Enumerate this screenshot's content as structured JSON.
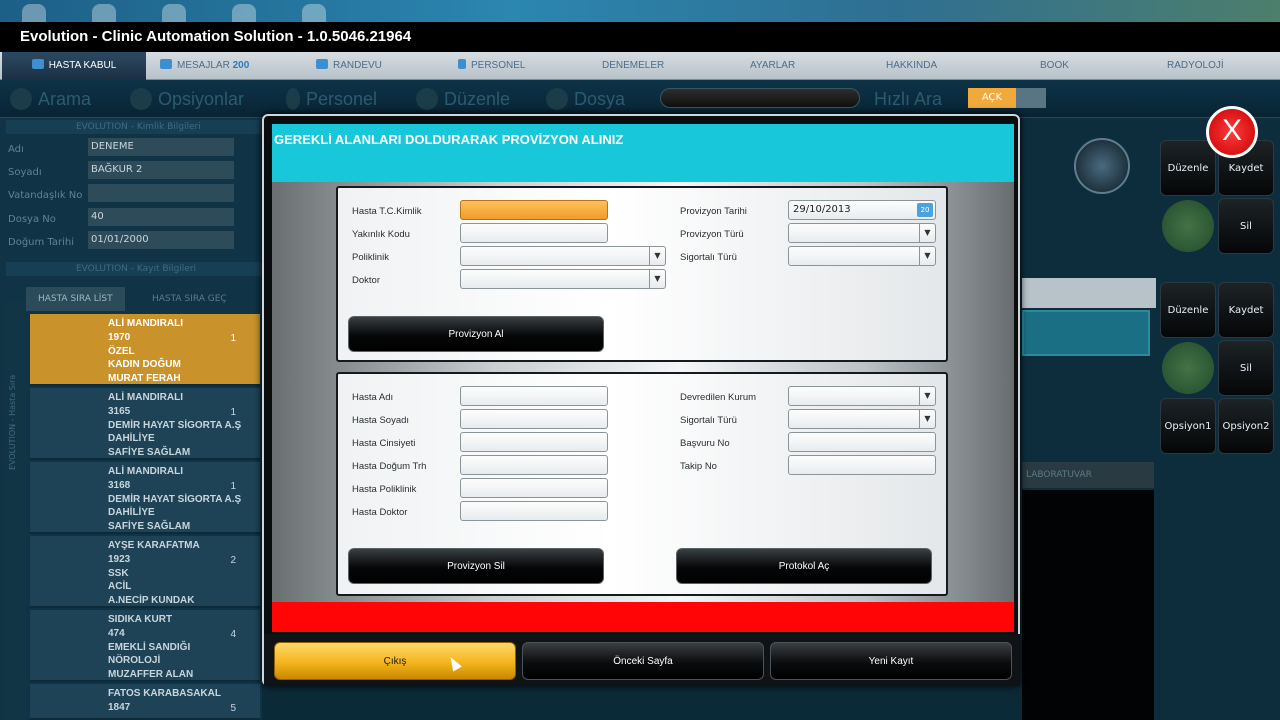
{
  "app": {
    "title": "Evolution - Clinic Automation Solution - 1.0.5046.21964"
  },
  "menu": {
    "items": [
      {
        "label": "HASTA KABUL"
      },
      {
        "label": "MESAJLAR",
        "badge": "200"
      },
      {
        "label": "RANDEVU"
      },
      {
        "label": "PERSONEL"
      },
      {
        "label": "DENEMELER"
      },
      {
        "label": "AYARLAR"
      },
      {
        "label": "HAKKINDA"
      },
      {
        "label": "BOOK"
      },
      {
        "label": "RADYOLOJİ"
      }
    ]
  },
  "toolbar": {
    "arama": "Arama",
    "opsiyonlar": "Opsiyonlar",
    "personel": "Personel",
    "duzenle": "Düzenle",
    "dosya": "Dosya",
    "hizli_ara": "Hızlı Ara",
    "ack": "AÇK"
  },
  "left": {
    "section1": "EVOLUTION - Kimlik Bilgileri",
    "fields": [
      {
        "label": "Adı",
        "value": "DENEME"
      },
      {
        "label": "Soyadı",
        "value": "BAĞKUR 2"
      },
      {
        "label": "Vatandaşlık No",
        "value": ""
      },
      {
        "label": "Dosya No",
        "value": "40"
      },
      {
        "label": "Doğum Tarihi",
        "value": "01/01/2000"
      }
    ],
    "section2": "EVOLUTION - Kayıt Bilgileri",
    "tabs": [
      "HASTA SIRA LİST",
      "HASTA SIRA GEÇ"
    ],
    "side_label": "EVOLUTION - Hasta Sıra",
    "patients": [
      {
        "lines": [
          "ALİ MANDIRALI",
          "1970",
          "ÖZEL",
          "KADIN DOĞUM",
          "MURAT FERAH"
        ],
        "n": "1"
      },
      {
        "lines": [
          "ALİ MANDIRALI",
          "3165",
          "DEMİR HAYAT SİGORTA A.Ş",
          "DAHİLİYE",
          "SAFİYE SAĞLAM"
        ],
        "n": "1"
      },
      {
        "lines": [
          "ALİ MANDIRALI",
          "3168",
          "DEMİR HAYAT SİGORTA A.Ş",
          "DAHİLİYE",
          "SAFİYE SAĞLAM"
        ],
        "n": "1"
      },
      {
        "lines": [
          "AYŞE KARAFATMA",
          "1923",
          "SSK",
          "ACİL",
          "A.NECİP KUNDAK"
        ],
        "n": "2"
      },
      {
        "lines": [
          "SIDIKA KURT",
          "474",
          "EMEKLİ SANDIĞI",
          "NÖROLOJİ",
          "MUZAFFER ALAN"
        ],
        "n": "4"
      },
      {
        "lines": [
          "FATOS KARABASAKAL",
          "1847",
          "",
          "",
          ""
        ],
        "n": "5"
      }
    ]
  },
  "right": {
    "btn_duzenle": "Düzenle",
    "btn_kaydet": "Kaydet",
    "btn_sil": "Sil",
    "btn_opsiyon1": "Opsiyon1",
    "btn_opsiyon2": "Opsiyon2",
    "lab": "LABORATUVAR",
    "close": "X"
  },
  "modal": {
    "title": "GEREKLİ ALANLARI DOLDURARAK PROVİZYON ALINIZ",
    "top": {
      "hasta_tc": "Hasta T.C.Kimlik",
      "yakinlik": "Yakınlık Kodu",
      "poliklinik": "Poliklinik",
      "doktor": "Doktor",
      "provizyon_tarihi": "Provizyon Tarihi",
      "provizyon_tarihi_value": "29/10/2013",
      "provizyon_turu": "Provizyon Türü",
      "sigortali_turu": "Sigortalı Türü",
      "btn_provizyon_al": "Provizyon Al"
    },
    "bottom": {
      "hasta_adi": "Hasta Adı",
      "hasta_soyadi": "Hasta Soyadı",
      "hasta_cinsiyeti": "Hasta Cinsiyeti",
      "hasta_dogum": "Hasta Doğum Trh",
      "hasta_poliklinik": "Hasta Poliklinik",
      "hasta_doktor": "Hasta Doktor",
      "devredilen_kurum": "Devredilen Kurum",
      "sigortali_turu": "Sigortalı Türü",
      "basvuru_no": "Başvuru No",
      "takip_no": "Takip No",
      "btn_provizyon_sil": "Provizyon Sil",
      "btn_protokol_ac": "Protokol Aç"
    },
    "footer": {
      "cikis": "Çıkış",
      "onceki": "Önceki Sayfa",
      "yeni": "Yeni Kayıt"
    }
  }
}
